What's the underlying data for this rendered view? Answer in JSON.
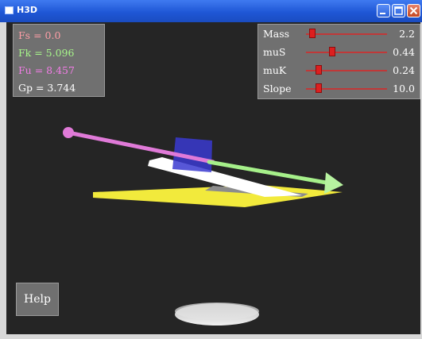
{
  "window": {
    "title": "H3D",
    "controls": [
      "minimize-icon",
      "maximize-icon",
      "close-icon"
    ],
    "titlebar_color": "#1f57d6"
  },
  "forces": [
    {
      "label": "Fs",
      "value": "0.0",
      "color": "#ff9ea6"
    },
    {
      "label": "Fk",
      "value": "5.096",
      "color": "#a7f58a"
    },
    {
      "label": "Fu",
      "value": "8.457",
      "color": "#f27de6"
    },
    {
      "label": "Gp",
      "value": "3.744",
      "color": "#ffffff"
    }
  ],
  "params": [
    {
      "label": "Mass",
      "value": "2.2",
      "level": 0.08
    },
    {
      "label": "muS",
      "value": "0.44",
      "level": 0.32
    },
    {
      "label": "muK",
      "value": "0.24",
      "level": 0.16
    },
    {
      "label": "Slope",
      "value": "10.0",
      "level": 0.16
    }
  ],
  "help_button": {
    "label": "Help"
  },
  "scene": {
    "background": "#252525",
    "slider_color": "#dd1f1f",
    "colors": {
      "pull_arrow": "#e07ad8",
      "friction_arrow": "#a6f08a",
      "block": "#3a3ad0",
      "ramp_top": "#ffffff",
      "base": "#f2ea3c",
      "pedestal": "#d8d8d8"
    }
  }
}
